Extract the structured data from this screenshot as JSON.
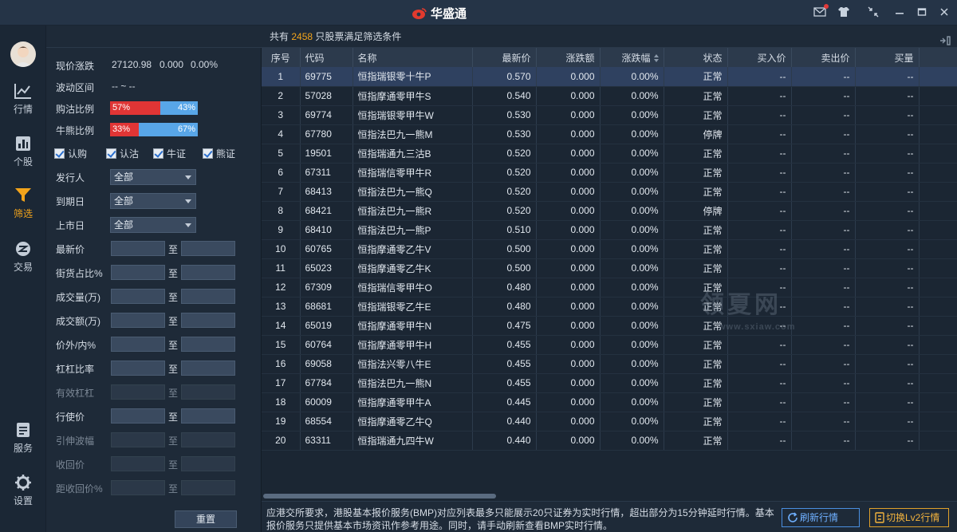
{
  "app": {
    "title": "华盛通"
  },
  "nav": {
    "items": [
      {
        "label": "行情",
        "icon": "chart-icon"
      },
      {
        "label": "个股",
        "icon": "bar-chart-icon"
      },
      {
        "label": "筛选",
        "icon": "filter-icon",
        "active": true
      },
      {
        "label": "交易",
        "icon": "trade-icon"
      },
      {
        "label": "服务",
        "icon": "document-icon"
      },
      {
        "label": "设置",
        "icon": "gear-icon"
      }
    ]
  },
  "filter": {
    "price_change_label": "现价涨跌",
    "price_value": "27120.98",
    "change_value": "0.000",
    "change_pct": "0.00%",
    "range_label": "波动区间",
    "range_value": "-- ~ --",
    "call_put_label": "购沽比例",
    "call_pct": "57%",
    "put_pct": "43%",
    "call_fraction": 0.57,
    "bull_bear_label": "牛熊比例",
    "bull_pct": "33%",
    "bear_pct": "67%",
    "bull_fraction": 0.33,
    "checks": [
      {
        "label": "认购",
        "checked": true
      },
      {
        "label": "认沽",
        "checked": true
      },
      {
        "label": "牛证",
        "checked": true
      },
      {
        "label": "熊证",
        "checked": true
      }
    ],
    "issuer_label": "发行人",
    "issuer_value": "全部",
    "expiry_label": "到期日",
    "expiry_value": "全部",
    "listing_label": "上市日",
    "listing_value": "全部",
    "to_label": "至",
    "ranges": [
      {
        "label": "最新价",
        "enabled": true
      },
      {
        "label": "街货占比%",
        "enabled": true
      },
      {
        "label": "成交量(万)",
        "enabled": true
      },
      {
        "label": "成交额(万)",
        "enabled": true
      },
      {
        "label": "价外/内%",
        "enabled": true
      },
      {
        "label": "杠杠比率",
        "enabled": true
      },
      {
        "label": "有效杠杠",
        "enabled": false
      },
      {
        "label": "行使价",
        "enabled": true
      },
      {
        "label": "引伸波幅",
        "enabled": false
      },
      {
        "label": "收回价",
        "enabled": false
      },
      {
        "label": "距收回价%",
        "enabled": false
      }
    ],
    "reset_label": "重置"
  },
  "main": {
    "summary_prefix": "共有",
    "summary_count": "2458",
    "summary_suffix": "只股票满足筛选条件",
    "columns": [
      "序号",
      "代码",
      "名称",
      "最新价",
      "涨跌额",
      "涨跌幅",
      "状态",
      "买入价",
      "卖出价",
      "买量"
    ],
    "rows": [
      [
        "1",
        "69775",
        "恒指瑞银零十牛P",
        "0.570",
        "0.000",
        "0.00%",
        "正常",
        "--",
        "--",
        "--"
      ],
      [
        "2",
        "57028",
        "恒指摩通零甲牛S",
        "0.540",
        "0.000",
        "0.00%",
        "正常",
        "--",
        "--",
        "--"
      ],
      [
        "3",
        "69774",
        "恒指瑞银零甲牛W",
        "0.530",
        "0.000",
        "0.00%",
        "正常",
        "--",
        "--",
        "--"
      ],
      [
        "4",
        "67780",
        "恒指法巴九一熊M",
        "0.530",
        "0.000",
        "0.00%",
        "停牌",
        "--",
        "--",
        "--"
      ],
      [
        "5",
        "19501",
        "恒指瑞通九三沽B",
        "0.520",
        "0.000",
        "0.00%",
        "正常",
        "--",
        "--",
        "--"
      ],
      [
        "6",
        "67311",
        "恒指瑞信零甲牛R",
        "0.520",
        "0.000",
        "0.00%",
        "正常",
        "--",
        "--",
        "--"
      ],
      [
        "7",
        "68413",
        "恒指法巴九一熊Q",
        "0.520",
        "0.000",
        "0.00%",
        "正常",
        "--",
        "--",
        "--"
      ],
      [
        "8",
        "68421",
        "恒指法巴九一熊R",
        "0.520",
        "0.000",
        "0.00%",
        "停牌",
        "--",
        "--",
        "--"
      ],
      [
        "9",
        "68410",
        "恒指法巴九一熊P",
        "0.510",
        "0.000",
        "0.00%",
        "正常",
        "--",
        "--",
        "--"
      ],
      [
        "10",
        "60765",
        "恒指摩通零乙牛V",
        "0.500",
        "0.000",
        "0.00%",
        "正常",
        "--",
        "--",
        "--"
      ],
      [
        "11",
        "65023",
        "恒指摩通零乙牛K",
        "0.500",
        "0.000",
        "0.00%",
        "正常",
        "--",
        "--",
        "--"
      ],
      [
        "12",
        "67309",
        "恒指瑞信零甲牛O",
        "0.480",
        "0.000",
        "0.00%",
        "正常",
        "--",
        "--",
        "--"
      ],
      [
        "13",
        "68681",
        "恒指瑞银零乙牛E",
        "0.480",
        "0.000",
        "0.00%",
        "正常",
        "--",
        "--",
        "--"
      ],
      [
        "14",
        "65019",
        "恒指摩通零甲牛N",
        "0.475",
        "0.000",
        "0.00%",
        "正常",
        "--",
        "--",
        "--"
      ],
      [
        "15",
        "60764",
        "恒指摩通零甲牛H",
        "0.455",
        "0.000",
        "0.00%",
        "正常",
        "--",
        "--",
        "--"
      ],
      [
        "16",
        "69058",
        "恒指法兴零八牛E",
        "0.455",
        "0.000",
        "0.00%",
        "正常",
        "--",
        "--",
        "--"
      ],
      [
        "17",
        "67784",
        "恒指法巴九一熊N",
        "0.455",
        "0.000",
        "0.00%",
        "正常",
        "--",
        "--",
        "--"
      ],
      [
        "18",
        "60009",
        "恒指摩通零甲牛A",
        "0.445",
        "0.000",
        "0.00%",
        "正常",
        "--",
        "--",
        "--"
      ],
      [
        "19",
        "68554",
        "恒指摩通零乙牛Q",
        "0.440",
        "0.000",
        "0.00%",
        "正常",
        "--",
        "--",
        "--"
      ],
      [
        "20",
        "63311",
        "恒指瑞通九四牛W",
        "0.440",
        "0.000",
        "0.00%",
        "正常",
        "--",
        "--",
        "--"
      ]
    ],
    "footer_note": "应港交所要求，港股基本报价服务(BMP)对应列表最多只能展示20只证券为实时行情，超出部分为15分钟延时行情。基本报价服务只提供基本市场资讯作参考用途。同时，请手动刷新查看BMP实时行情。",
    "refresh_label": "刷新行情",
    "lv2_label": "切换Lv2行情",
    "watermark": "领夏网",
    "watermark_sub": "www.sxiaw.com"
  }
}
